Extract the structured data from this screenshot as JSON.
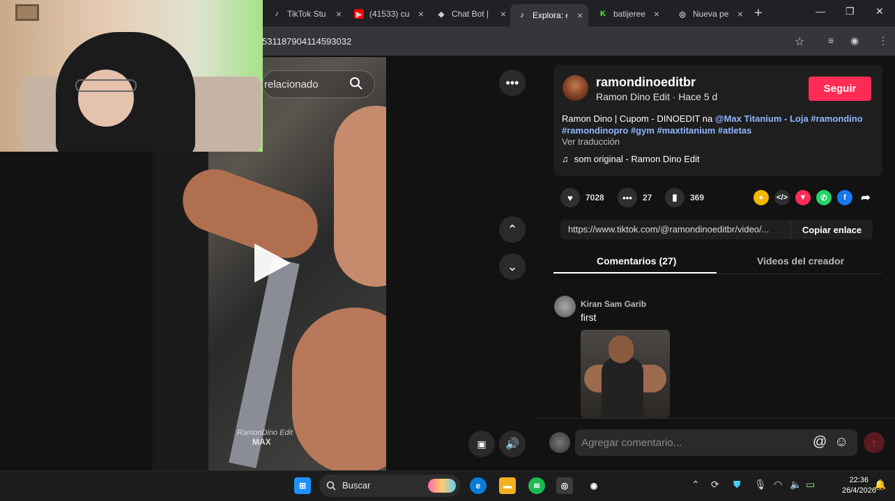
{
  "browser": {
    "tabs": [
      {
        "title": "TikTok Stu",
        "icon": "tiktok-icon"
      },
      {
        "title": "(41533) cu",
        "icon": "youtube-icon"
      },
      {
        "title": "Chat Bot |",
        "icon": "chatbot-icon"
      },
      {
        "title": "Explora: e",
        "icon": "tiktok-icon",
        "active": true
      },
      {
        "title": "batijeree",
        "icon": "kick-icon"
      },
      {
        "title": "Nueva pe",
        "icon": "chrome-icon"
      }
    ],
    "url": "531187904114593032"
  },
  "video": {
    "search_text": "relacionado",
    "watermark": "RamonDino Edit",
    "watermark_brand": "MAX"
  },
  "post": {
    "username": "ramondinoeditbr",
    "subtitle": "Ramon Dino Edit · Hace 5 d",
    "follow_label": "Seguir",
    "desc_text": "Ramon Dino | Cupom - DINOEDIT na ",
    "desc_tags_1": "@Max Titanium - Loja #ramondino",
    "desc_tags_2": "#ramondinopro #gym #maxtitanium #atletas",
    "translate": "Ver traducción",
    "music": "som original - Ramon Dino Edit",
    "likes": "7028",
    "comments": "27",
    "saves": "369",
    "link": "https://www.tiktok.com/@ramondinoeditbr/video/...",
    "copy_label": "Copiar enlace"
  },
  "tabs": {
    "comments": "Comentarios (27)",
    "creator": "Videos del creador"
  },
  "comment": {
    "author": "Kiran Sam Garib",
    "text": "first"
  },
  "input": {
    "placeholder": "Agregar comentario..."
  },
  "taskbar": {
    "search": "Buscar",
    "time": "22:36",
    "date": "26/4/2026"
  },
  "colors": {
    "accent": "#fe2c55",
    "tag": "#8fb7ff"
  }
}
